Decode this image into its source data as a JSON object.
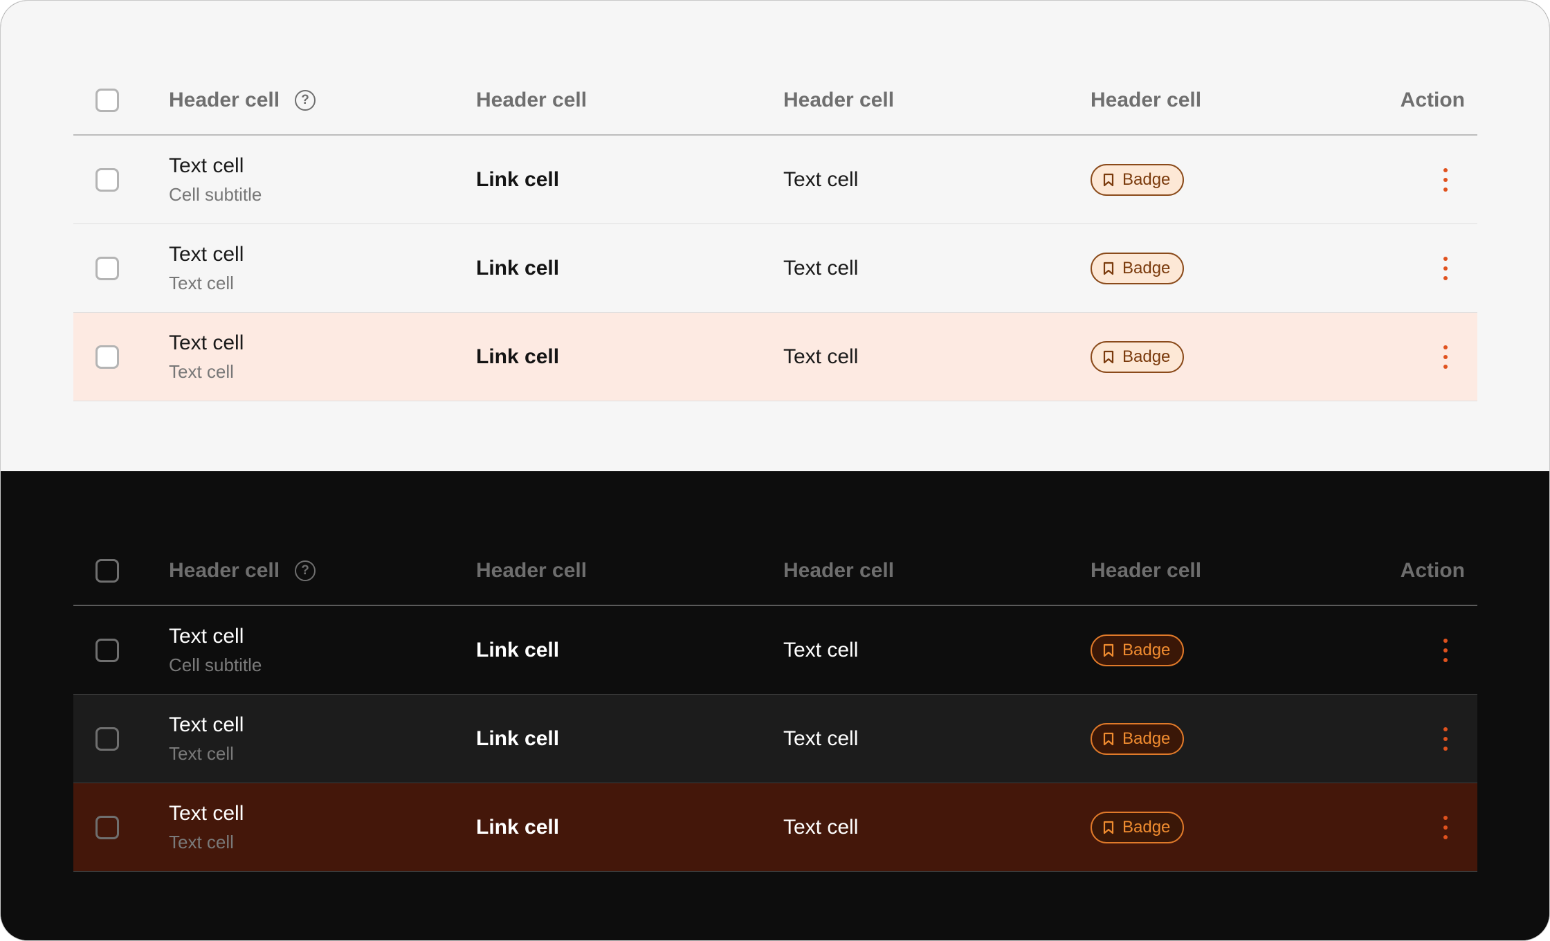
{
  "light": {
    "header": {
      "col1": "Header cell",
      "help": "?",
      "col2": "Header cell",
      "col3": "Header cell",
      "col4": "Header cell",
      "action": "Action"
    },
    "rows": [
      {
        "title": "Text cell",
        "subtitle": "Cell subtitle",
        "link": "Link cell",
        "text": "Text cell",
        "badge": "Badge"
      },
      {
        "title": "Text cell",
        "subtitle": "Text cell",
        "link": "Link cell",
        "text": "Text cell",
        "badge": "Badge"
      },
      {
        "title": "Text cell",
        "subtitle": "Text cell",
        "link": "Link cell",
        "text": "Text cell",
        "badge": "Badge"
      }
    ]
  },
  "dark": {
    "header": {
      "col1": "Header cell",
      "help": "?",
      "col2": "Header cell",
      "col3": "Header cell",
      "col4": "Header cell",
      "action": "Action"
    },
    "rows": [
      {
        "title": "Text cell",
        "subtitle": "Cell subtitle",
        "link": "Link cell",
        "text": "Text cell",
        "badge": "Badge"
      },
      {
        "title": "Text cell",
        "subtitle": "Text cell",
        "link": "Link cell",
        "text": "Text cell",
        "badge": "Badge"
      },
      {
        "title": "Text cell",
        "subtitle": "Text cell",
        "link": "Link cell",
        "text": "Text cell",
        "badge": "Badge"
      }
    ]
  },
  "icons": {
    "help": "question-circle-icon",
    "badge": "bookmark-icon",
    "action": "more-vertical-icon"
  },
  "colors": {
    "accent": "#e0521e",
    "selected_light": "#fdeae2",
    "selected_dark": "#44170a"
  }
}
